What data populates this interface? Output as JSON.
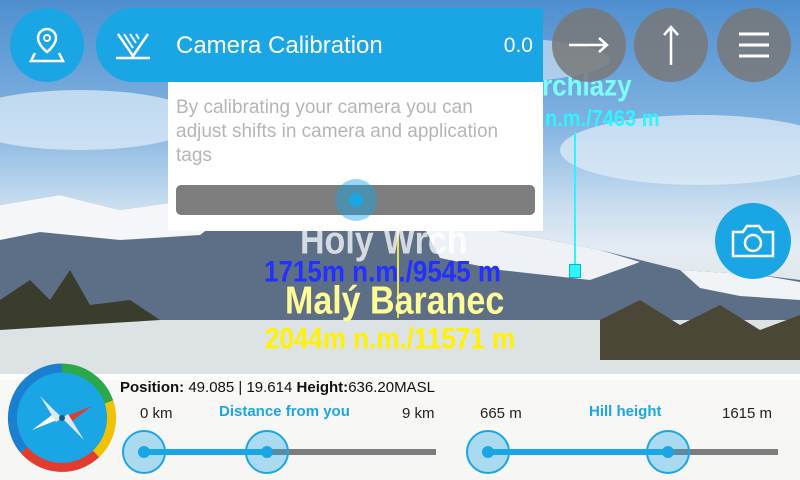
{
  "camera_labels": {
    "peak1_name": "rchlazy",
    "peak1_info": "n.m./7463 m",
    "peak2_name": "Holý Wrch",
    "peak2_info": "1715m n.m./9545 m",
    "peak3_name": "Malý Baranec",
    "peak3_info": "2044m n.m./11571 m"
  },
  "toolbar": {
    "map_icon": "map-pin-icon",
    "calibration_icon": "calibration-icon",
    "forward_icon": "arrow-right-icon",
    "up_icon": "arrow-up-icon",
    "menu_icon": "menu-icon",
    "camera_icon": "camera-icon"
  },
  "calibration": {
    "title": "Camera Calibration",
    "value": "0.0",
    "description": "By calibrating your camera you can adjust shifts in camera and application tags",
    "slider_level": 0.5
  },
  "status": {
    "position_label": "Position:",
    "position_value": "49.085 | 19.614",
    "height_label": "Height:",
    "height_value": "636.20MASL"
  },
  "distance": {
    "label": "Distance from you",
    "min": "0 km",
    "max": "9 km",
    "low": 0.0,
    "high": 0.42
  },
  "hill_height": {
    "label": "Hill height",
    "min": "665 m",
    "max": "1615 m",
    "low": 0.0,
    "high": 0.62
  },
  "colors": {
    "accent": "#1aa6e4",
    "panel": "#ffffff",
    "track": "#7d7d7d"
  }
}
